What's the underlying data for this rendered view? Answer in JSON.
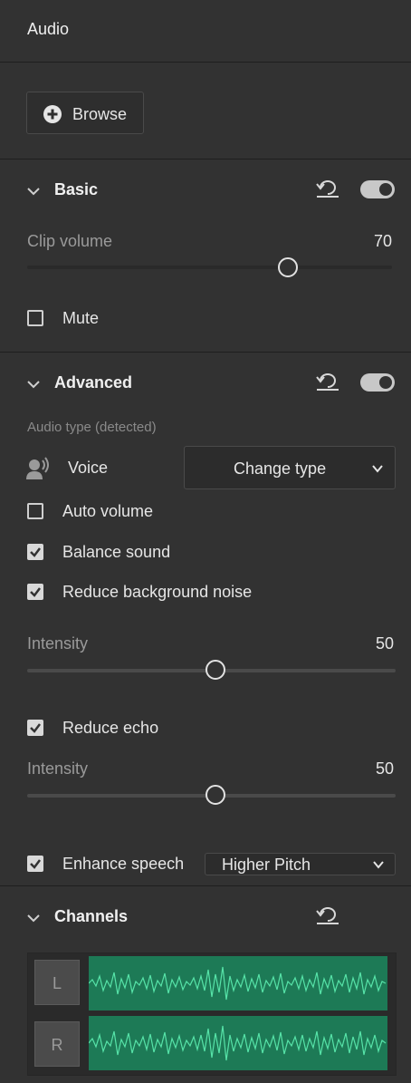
{
  "panel": {
    "title": "Audio"
  },
  "browse": {
    "label": "Browse"
  },
  "basic": {
    "title": "Basic",
    "enabled": true,
    "clip_volume_label": "Clip volume",
    "clip_volume_value": "70",
    "clip_volume_fraction": 0.7,
    "mute_label": "Mute",
    "mute_checked": false
  },
  "advanced": {
    "title": "Advanced",
    "enabled": true,
    "audio_type_label": "Audio type (detected)",
    "voice_label": "Voice",
    "change_type_label": "Change type",
    "auto_volume_label": "Auto volume",
    "auto_volume_checked": false,
    "balance_label": "Balance sound",
    "balance_checked": true,
    "reduce_noise_label": "Reduce background noise",
    "reduce_noise_checked": true,
    "noise_intensity_label": "Intensity",
    "noise_intensity_value": "50",
    "noise_intensity_fraction": 0.5,
    "reduce_echo_label": "Reduce echo",
    "reduce_echo_checked": true,
    "echo_intensity_label": "Intensity",
    "echo_intensity_value": "50",
    "echo_intensity_fraction": 0.5,
    "enhance_label": "Enhance speech",
    "enhance_checked": true,
    "enhance_selected": "Higher Pitch"
  },
  "channels": {
    "title": "Channels",
    "left_label": "L",
    "right_label": "R"
  },
  "colors": {
    "panel_bg": "#323232",
    "waveform_bg": "#1d7a56",
    "waveform_line": "#56e3a8"
  },
  "icons": [
    "plus-circle-icon",
    "chevron-down-icon",
    "reset-icon",
    "toggle-switch",
    "speaker-voice-icon",
    "checkbox"
  ]
}
